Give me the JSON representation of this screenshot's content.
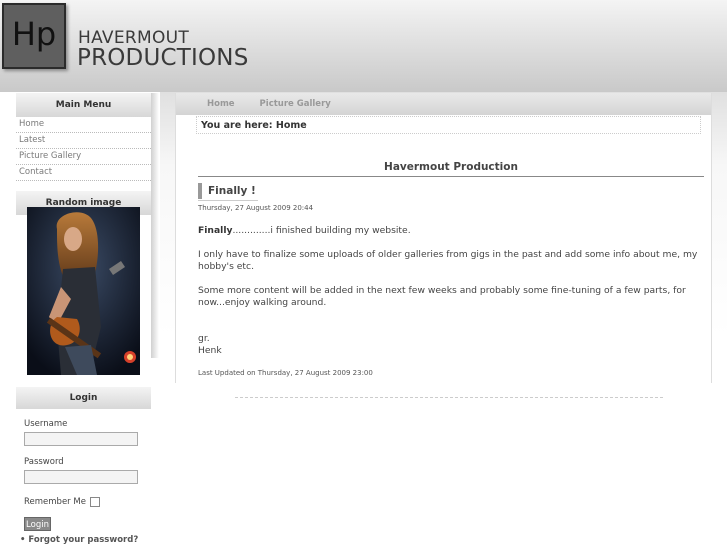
{
  "header": {
    "logo_text": "Hp",
    "brand_line1": "HAVERMOUT",
    "brand_line2": "PRODUCTIONS"
  },
  "main_menu": {
    "title": "Main Menu",
    "items": [
      "Home",
      "Latest",
      "Picture Gallery",
      "Contact"
    ]
  },
  "random_image": {
    "title": "Random image",
    "image_description": "guitarist-photo"
  },
  "login": {
    "title": "Login",
    "username_label": "Username",
    "password_label": "Password",
    "remember_label": "Remember Me",
    "button_label": "Login",
    "forgot_link": "Forgot your password?",
    "username_value": "",
    "password_value": "",
    "remember_checked": false
  },
  "topnav": {
    "items": [
      "Home",
      "Picture Gallery"
    ]
  },
  "breadcrumb": "You are here: Home",
  "page_title": "Havermout Production",
  "article": {
    "title": "Finally !",
    "date": "Thursday, 27 August 2009 20:44",
    "p1_bold": "Finally",
    "p1_rest": ".............i finished building my website.",
    "p2": "I only have to finalize some uploads of older galleries from gigs in the past and add some info about me, my hobby's etc.",
    "p3": "Some more content will be added in the next few weeks and probably some fine-tuning of a few parts, for now...enjoy walking around.",
    "p4_line1": "gr.",
    "p4_line2": "Henk",
    "updated": "Last Updated on Thursday, 27 August 2009 23:00"
  }
}
